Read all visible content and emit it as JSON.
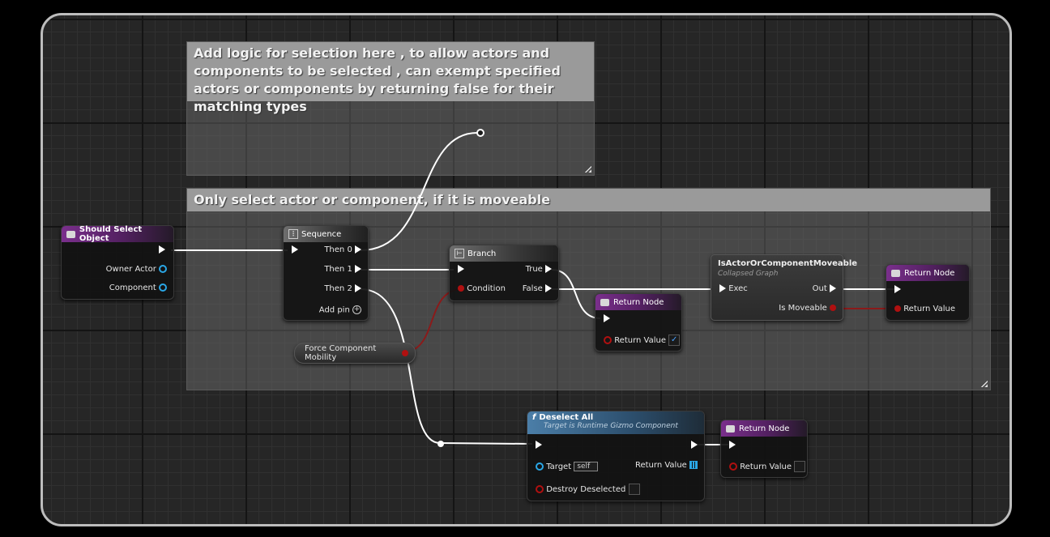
{
  "comments": {
    "top": "Add logic for selection here , to allow actors and components to be selected , can exempt specified actors or components by returning false for their matching types",
    "middle": "Only select actor or component, if it is moveable"
  },
  "nodes": {
    "should_select": {
      "title": "Should Select Object",
      "pins": [
        "Owner Actor",
        "Component"
      ]
    },
    "sequence": {
      "title": "Sequence",
      "pins": [
        "Then 0",
        "Then 1",
        "Then 2"
      ],
      "add_pin": "Add pin"
    },
    "branch": {
      "title": "Branch",
      "condition": "Condition",
      "true_label": "True",
      "false_label": "False"
    },
    "return_mid": {
      "title": "Return Node",
      "pin": "Return Value",
      "check": "✓"
    },
    "force_mobility": {
      "title": "Force Component Mobility"
    },
    "is_moveable": {
      "title": "IsActorOrComponentMoveable",
      "subtitle": "Collapsed Graph",
      "exec": "Exec",
      "out": "Out",
      "is_moveable": "Is Moveable"
    },
    "return_right": {
      "title": "Return Node",
      "pin": "Return Value"
    },
    "deselect_all": {
      "title": "Deselect All",
      "subtitle": "Target is Runtime Gizmo Component",
      "target": "Target",
      "self": "self",
      "return_value": "Return Value",
      "destroy": "Destroy Deselected"
    },
    "return_bottom": {
      "title": "Return Node",
      "pin": "Return Value"
    }
  },
  "colors": {
    "exec_wire": "#ffffff",
    "bool_wire": "#8b1a1a",
    "object_pin": "#2aa7e6",
    "function_header": "#4b7ea8",
    "event_header": "#7a2f8c"
  }
}
